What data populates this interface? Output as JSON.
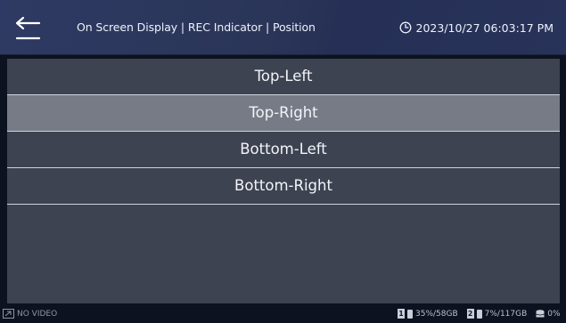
{
  "header": {
    "title": "On Screen Display | REC Indicator | Position",
    "datetime": "2023/10/27 06:03:17 PM"
  },
  "menu": {
    "items": [
      {
        "label": "Top-Left",
        "selected": false
      },
      {
        "label": "Top-Right",
        "selected": true
      },
      {
        "label": "Bottom-Left",
        "selected": false
      },
      {
        "label": "Bottom-Right",
        "selected": false
      }
    ]
  },
  "statusbar": {
    "video_status": "NO VIDEO",
    "drives": [
      {
        "index": "1",
        "usage": "35%/58GB"
      },
      {
        "index": "2",
        "usage": "7%/117GB"
      }
    ],
    "storage_usage": "0%"
  },
  "colors": {
    "header_bg": "#2e3a63",
    "menu_bg": "#3e4352",
    "selected_bg": "#767b86",
    "screen_bg": "#0d1220"
  },
  "icons": [
    "back-icon",
    "clock-icon",
    "video-input-icon",
    "disk-icon",
    "database-icon"
  ]
}
